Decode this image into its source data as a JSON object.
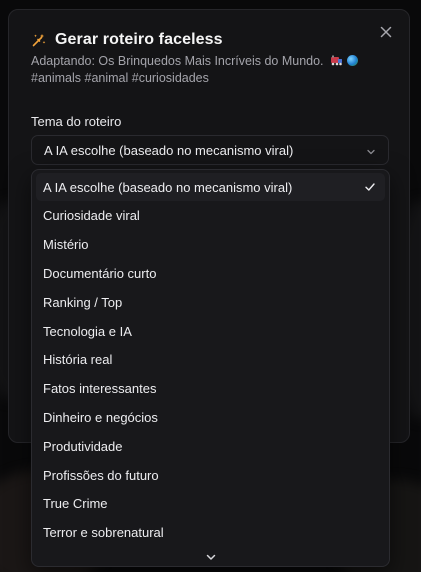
{
  "dialog": {
    "title": "Gerar roteiro faceless",
    "subtitle_line1": "Adaptando: Os Brinquedos Mais Incríveis do Mundo.",
    "subtitle_line2": "#animals #animal #curiosidades",
    "close_icon": "close-icon",
    "title_icon": "magic-wand-icon"
  },
  "theme_field": {
    "label": "Tema do roteiro",
    "selected_value": "A IA escolhe (baseado no mecanismo viral)"
  },
  "dropdown": {
    "options": [
      "A IA escolhe (baseado no mecanismo viral)",
      "Curiosidade viral",
      "Mistério",
      "Documentário curto",
      "Ranking / Top",
      "Tecnologia e IA",
      "História real",
      "Fatos interessantes",
      "Dinheiro e negócios",
      "Produtividade",
      "Profissões do futuro",
      "True Crime",
      "Terror e sobrenatural"
    ],
    "selected_index": 0,
    "scroll_icon": "chevron-down-icon"
  },
  "colors": {
    "accent_wand": "#f2a33a",
    "panel_bg": "#141416",
    "dropdown_bg": "#18181b"
  }
}
